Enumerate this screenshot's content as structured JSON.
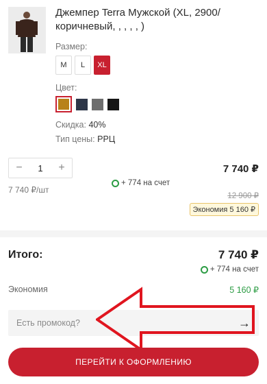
{
  "product": {
    "title": "Джемпер Terra Мужской (XL, 2900/ коричневый, , , , , )",
    "size_label": "Размер:",
    "sizes": [
      "M",
      "L",
      "XL"
    ],
    "selected_size": "XL",
    "color_label": "Цвет:",
    "colors": [
      "#b8821a",
      "#2d3648",
      "#6e6e6e",
      "#151515"
    ],
    "discount_key": "Скидка:",
    "discount_value": "40%",
    "price_type_key": "Тип цены:",
    "price_type_value": "РРЦ"
  },
  "cart_item": {
    "quantity": "1",
    "minus": "−",
    "plus": "+",
    "unit_price": "7 740 ₽/шт",
    "price": "7 740 ₽",
    "bonus": "+ 774 на счет",
    "old_price": "12 900 ₽",
    "economy_badge": "Экономия 5 160 ₽"
  },
  "summary": {
    "total_label": "Итого:",
    "total_value": "7 740 ₽",
    "bonus": "+ 774 на счет",
    "economy_label": "Экономия",
    "economy_value": "5 160 ₽"
  },
  "promo": {
    "placeholder": "Есть промокод?",
    "submit_icon": "→"
  },
  "checkout": {
    "label": "ПЕРЕЙТИ К ОФОРМЛЕНИЮ"
  },
  "accent_color": "#c8202f",
  "bonus_color": "#2c9c44"
}
